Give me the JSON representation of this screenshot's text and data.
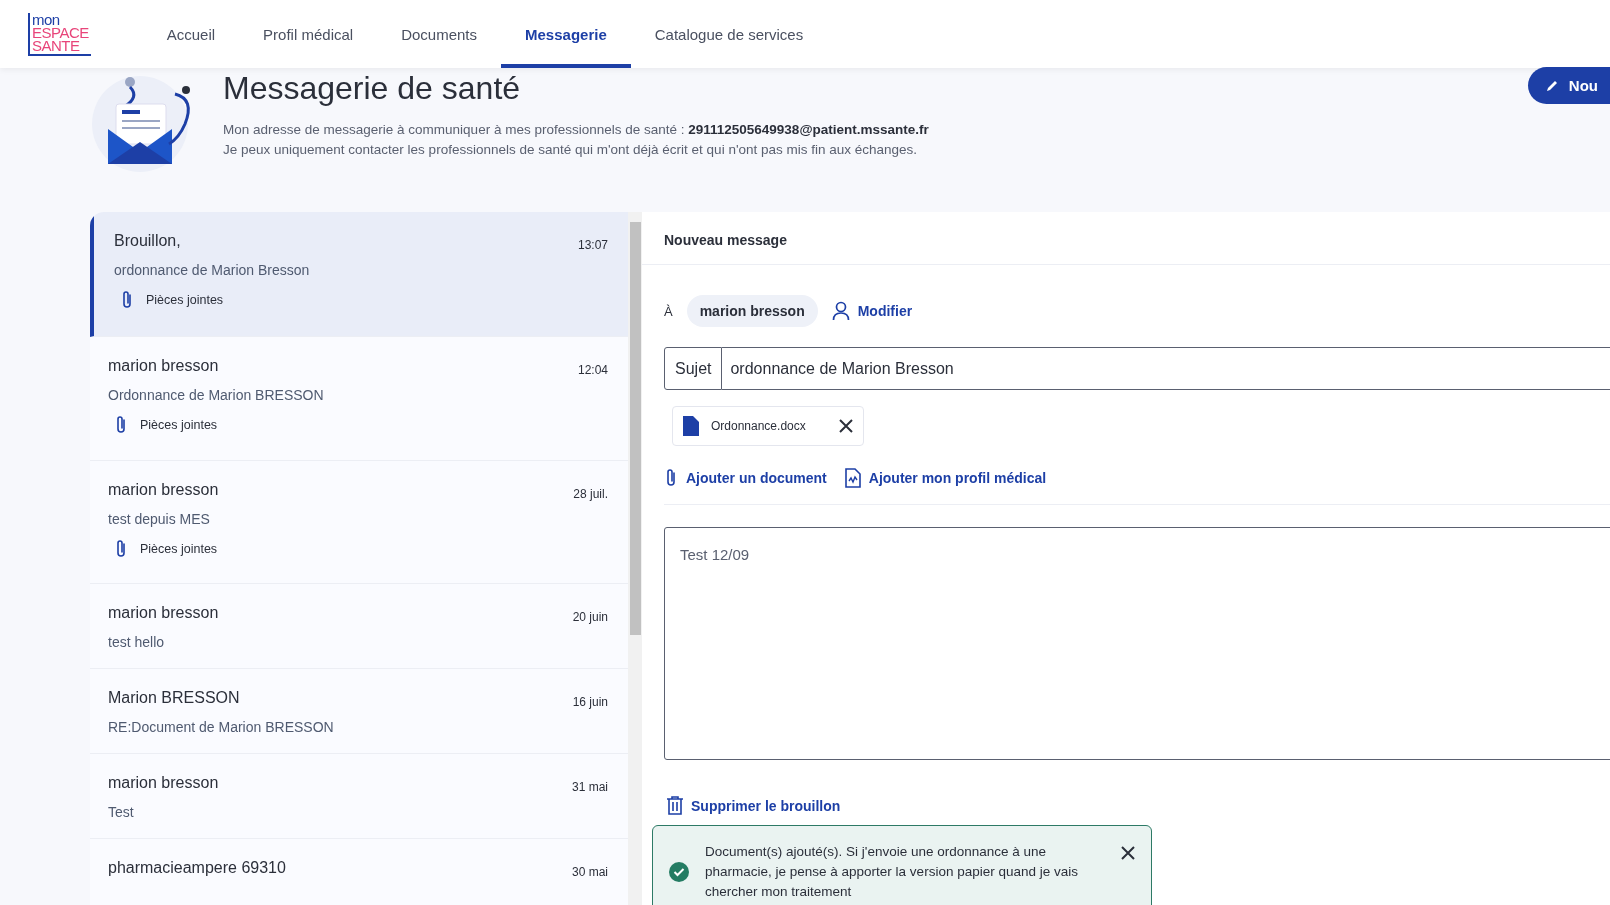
{
  "header": {
    "logo": [
      "mon",
      "ESPACE",
      "SANTE"
    ],
    "nav": [
      {
        "label": "Accueil",
        "selected": false
      },
      {
        "label": "Profil médical",
        "selected": false
      },
      {
        "label": "Documents",
        "selected": false
      },
      {
        "label": "Messagerie",
        "selected": true
      },
      {
        "label": "Catalogue de services",
        "selected": false
      }
    ]
  },
  "new_button": {
    "label": "Nou"
  },
  "hero": {
    "title": "Messagerie de santé",
    "address_line": "Mon adresse de messagerie à communiquer à mes professionnels de santé : **291112505649938@patient.mssante.fr**",
    "note": "Je peux uniquement contacter les professionnels de santé qui m'ont déjà écrit et qui n'ont pas mis fin aux échanges."
  },
  "messages": [
    {
      "sender": "Brouillon,",
      "subject": "ordonnance de Marion Bresson",
      "time": "13:07",
      "attachments": "Pièces jointes",
      "selected": true
    },
    {
      "sender": "marion bresson",
      "subject": "Ordonnance de Marion BRESSON",
      "time": "12:04",
      "attachments": "Pièces jointes",
      "selected": false
    },
    {
      "sender": "marion bresson",
      "subject": "test depuis MES",
      "time": "28 juil.",
      "attachments": "Pièces jointes",
      "selected": false
    },
    {
      "sender": "marion bresson",
      "subject": "test hello",
      "time": "20 juin",
      "selected": false
    },
    {
      "sender": "Marion BRESSON",
      "subject": "RE:Document de Marion BRESSON",
      "time": "16 juin",
      "selected": false
    },
    {
      "sender": "marion bresson",
      "subject": "Test",
      "time": "31 mai",
      "selected": false
    },
    {
      "sender": "pharmacieampere 69310",
      "time": "30 mai",
      "selected": false
    }
  ],
  "compose": {
    "title": "Nouveau message",
    "to_label": "À",
    "recipient": "marion bresson",
    "modify": "Modifier",
    "subject_label": "Sujet",
    "subject": "ordonnance de Marion Bresson",
    "attachment": "Ordonnance.docx",
    "add_document": "Ajouter un document",
    "add_profile": "Ajouter mon profil médical",
    "body": "Test 12/09",
    "delete_draft": "Supprimer le brouillon"
  },
  "toast": {
    "message": "Document(s) ajouté(s). Si j'envoie une ordonnance à une pharmacie, je pense à apporter la version papier quand je vais chercher mon traitement"
  }
}
